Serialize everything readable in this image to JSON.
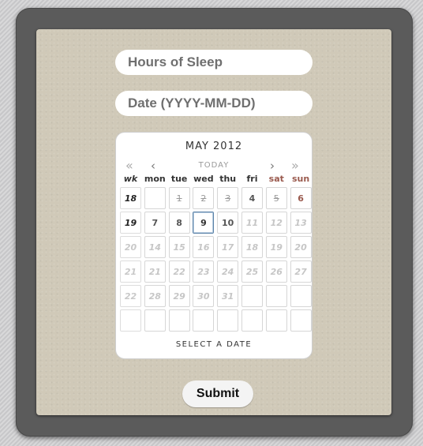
{
  "form": {
    "hours_placeholder": "Hours of Sleep",
    "date_placeholder": "Date (YYYY-MM-DD)",
    "submit_label": "Submit"
  },
  "calendar": {
    "title": "MAY 2012",
    "nav": {
      "prev_year": "«",
      "prev_month": "‹",
      "today": "TODAY",
      "next_month": "›",
      "next_year": "»"
    },
    "headers": [
      "wk",
      "mon",
      "tue",
      "wed",
      "thu",
      "fri",
      "sat",
      "sun"
    ],
    "rows": [
      {
        "week": "18",
        "days": [
          {
            "text": "",
            "state": "empty"
          },
          {
            "text": "1",
            "state": "past"
          },
          {
            "text": "2",
            "state": "past"
          },
          {
            "text": "3",
            "state": "past"
          },
          {
            "text": "4",
            "state": "normal"
          },
          {
            "text": "5",
            "state": "past"
          },
          {
            "text": "6",
            "state": "weekend"
          }
        ]
      },
      {
        "week": "19",
        "days": [
          {
            "text": "7",
            "state": "normal"
          },
          {
            "text": "8",
            "state": "normal"
          },
          {
            "text": "9",
            "state": "selected"
          },
          {
            "text": "10",
            "state": "normal"
          },
          {
            "text": "11",
            "state": "off"
          },
          {
            "text": "12",
            "state": "off"
          },
          {
            "text": "13",
            "state": "off"
          }
        ]
      },
      {
        "week": "20",
        "weekOff": true,
        "days": [
          {
            "text": "14",
            "state": "off"
          },
          {
            "text": "15",
            "state": "off"
          },
          {
            "text": "16",
            "state": "off"
          },
          {
            "text": "17",
            "state": "off"
          },
          {
            "text": "18",
            "state": "off"
          },
          {
            "text": "19",
            "state": "off"
          },
          {
            "text": "20",
            "state": "off"
          }
        ]
      },
      {
        "week": "21",
        "weekOff": true,
        "days": [
          {
            "text": "21",
            "state": "off"
          },
          {
            "text": "22",
            "state": "off"
          },
          {
            "text": "23",
            "state": "off"
          },
          {
            "text": "24",
            "state": "off"
          },
          {
            "text": "25",
            "state": "off"
          },
          {
            "text": "26",
            "state": "off"
          },
          {
            "text": "27",
            "state": "off"
          }
        ]
      },
      {
        "week": "22",
        "weekOff": true,
        "days": [
          {
            "text": "28",
            "state": "off"
          },
          {
            "text": "29",
            "state": "off"
          },
          {
            "text": "30",
            "state": "off"
          },
          {
            "text": "31",
            "state": "off"
          },
          {
            "text": "",
            "state": "empty"
          },
          {
            "text": "",
            "state": "empty"
          },
          {
            "text": "",
            "state": "empty"
          }
        ]
      },
      {
        "week": "",
        "days": [
          {
            "text": "",
            "state": "empty"
          },
          {
            "text": "",
            "state": "empty"
          },
          {
            "text": "",
            "state": "empty"
          },
          {
            "text": "",
            "state": "empty"
          },
          {
            "text": "",
            "state": "empty"
          },
          {
            "text": "",
            "state": "empty"
          },
          {
            "text": "",
            "state": "empty"
          }
        ]
      }
    ],
    "footer": "SELECT A DATE"
  }
}
